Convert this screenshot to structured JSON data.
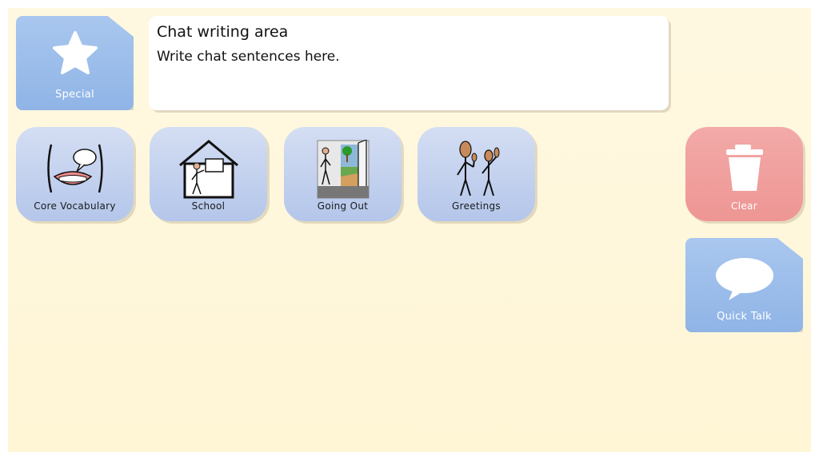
{
  "chat": {
    "title": "Chat writing area",
    "placeholder": "Write chat sentences here."
  },
  "tiles": {
    "special": "Special",
    "core_vocabulary": "Core Vocabulary",
    "school": "School",
    "going_out": "Going Out",
    "greetings": "Greetings",
    "clear": "Clear",
    "quick_talk": "Quick Talk"
  },
  "icons": {
    "special": "star-icon",
    "core_vocabulary": "mouth-speech-icon",
    "school": "school-house-icon",
    "going_out": "open-door-icon",
    "greetings": "waving-people-icon",
    "clear": "trash-bin-icon",
    "quick_talk": "speech-bubble-icon"
  },
  "colors": {
    "background": "#fff8e1",
    "folder_tile": "#c4d3ef",
    "special_tile": "#9fbeec",
    "clear_tile": "#f0a0a0"
  }
}
